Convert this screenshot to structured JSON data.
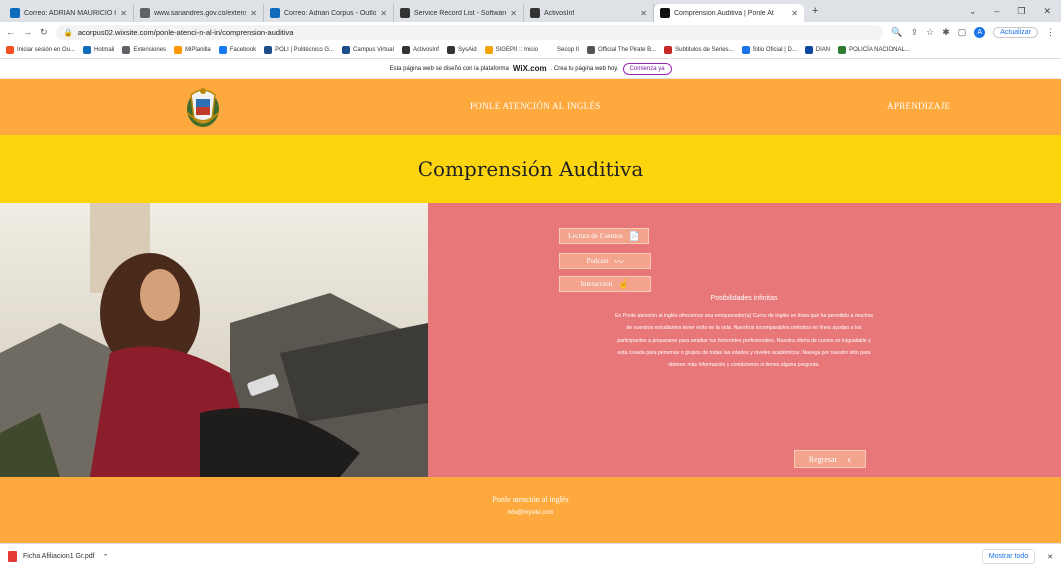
{
  "browser": {
    "tabs": [
      {
        "label": "Correo: ADRIAN MAURICIO COR",
        "color": "#0f6cbd"
      },
      {
        "label": "www.sanandres.gov.co/extensio",
        "color": "#5f6368"
      },
      {
        "label": "Correo: Adrian Corpus - Outlook",
        "color": "#0f6cbd"
      },
      {
        "label": "Service Record List - Software de",
        "color": "#333"
      },
      {
        "label": "ActivosInf",
        "color": "#333"
      },
      {
        "label": "Comprension Auditiva | Ponle At",
        "color": "#111",
        "active": true
      }
    ],
    "new_tab": "+",
    "url": "acorpus02.wixsite.com/ponle-atenci-n-al-in/comprension-auditiva",
    "update_label": "Actualizar",
    "avatar_letter": "A"
  },
  "bookmarks": [
    {
      "label": "Iniciar sesión en Ou...",
      "color": "#f25022"
    },
    {
      "label": "Hotmail",
      "color": "#0f6cbd"
    },
    {
      "label": "Extensiones",
      "color": "#5f6368"
    },
    {
      "label": "MiPlanilla",
      "color": "#ff9800"
    },
    {
      "label": "Facebook",
      "color": "#1877f2"
    },
    {
      "label": "POLI | Politécnico G...",
      "color": "#1d4e89"
    },
    {
      "label": "Campus Virtual",
      "color": "#1d4e89"
    },
    {
      "label": "ActivosInf",
      "color": "#333"
    },
    {
      "label": "SysAid",
      "color": "#333"
    },
    {
      "label": "SIGEPII :: Inicio",
      "color": "#f4a300"
    },
    {
      "label": "Secop II",
      "color": "#fff"
    },
    {
      "label": "Official The Pirate B...",
      "color": "#555"
    },
    {
      "label": "Subtitulos de Series...",
      "color": "#c62828"
    },
    {
      "label": "Sitio Oficial | D...",
      "color": "#1a73e8"
    },
    {
      "label": "DIAN",
      "color": "#0d47a1"
    },
    {
      "label": "POLICÍA NACIONAL...",
      "color": "#2e7d32"
    }
  ],
  "wix_banner": {
    "text": "Esta página web se diseñó con la plataforma",
    "brand": "WiX.com",
    "text2": ". Crea tu página web hoy.",
    "button": "Comienza ya"
  },
  "site": {
    "nav_center": "PONLE ATENCIÓN AL INGLÉS",
    "nav_right": "APRENDIZAJE",
    "page_title": "Comprensión Auditiva",
    "buttons": [
      {
        "label": "Lectura de Cuentos",
        "icon": "📄"
      },
      {
        "label": "Podcast",
        "icon": "〰"
      },
      {
        "label": "Interaccion",
        "icon": "☝"
      }
    ],
    "section_title": "Posibilidades infinitas",
    "section_text": "En Ponle atención al inglés ofrecemos una enriquecedor(a) Curso de Inglés en línea que ha permitido a muchos de nuestros estudiantes tener éxito en la vida. Nuestros incomparables métodos en línea ayudan a los participantes a prepararse para ampliar tus horizontes profesionales. Nuestra oferta de cursos es inigualable y está creada para personas o grupos de todas las edades y niveles académicos. Navega por nuestro sitio para obtener más información y contáctenos si tienes alguna pregunta.",
    "back_button": "Regresar",
    "back_icon": "‹",
    "footer_name": "Ponle atención al inglés",
    "footer_email": "info@mysite.com"
  },
  "downloads": {
    "file": "Ficha Afiliacion1 Gr.pdf",
    "show_all": "Mostrar todo",
    "close": "✕"
  },
  "colors": {
    "header": "#fea93d",
    "title_band": "#fcd50e",
    "content_bg": "#e87779",
    "button_bg": "#f2a48d"
  }
}
